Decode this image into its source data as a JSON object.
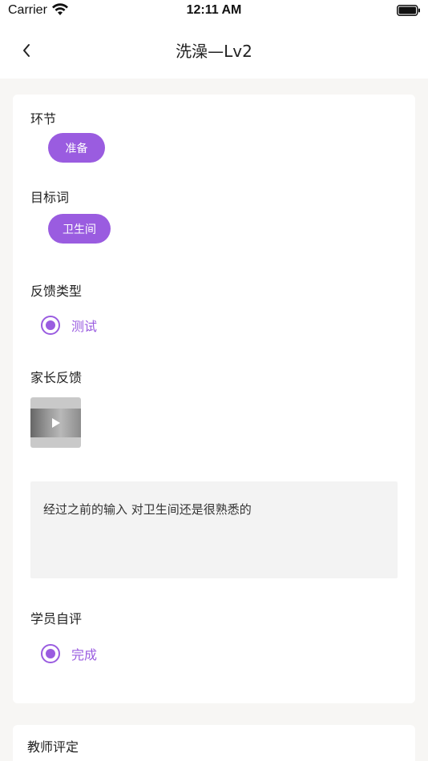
{
  "status_bar": {
    "carrier": "Carrier",
    "time": "12:11 AM"
  },
  "nav": {
    "title": "洗澡—Lv2",
    "back_icon": "chevron-left-icon"
  },
  "sections": {
    "stage": {
      "label": "环节",
      "value": "准备"
    },
    "target_word": {
      "label": "目标词",
      "value": "卫生间"
    },
    "feedback_type": {
      "label": "反馈类型",
      "option": "测试",
      "selected": true
    },
    "parent_feedback": {
      "label": "家长反馈",
      "video_icon": "play-icon",
      "text": "经过之前的输入 对卫生间还是很熟悉的"
    },
    "self_eval": {
      "label": "学员自评",
      "option": "完成",
      "selected": true
    }
  },
  "teacher_section": {
    "label": "教师评定"
  },
  "colors": {
    "accent": "#9a5ce0",
    "background": "#f7f6f4",
    "card": "#ffffff",
    "input_bg": "#f3f3f3"
  }
}
